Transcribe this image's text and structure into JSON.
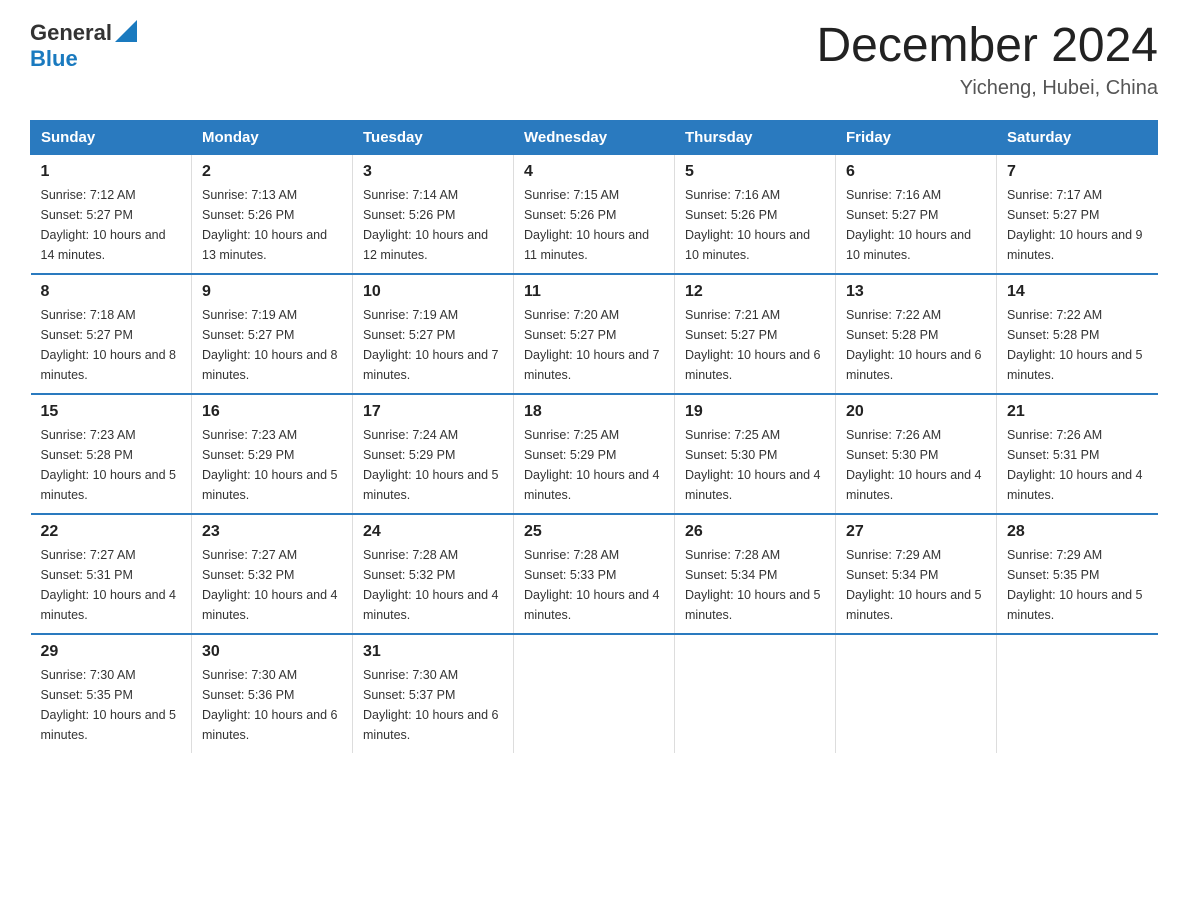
{
  "header": {
    "logo": {
      "general": "General",
      "blue": "Blue"
    },
    "title": "December 2024",
    "location": "Yicheng, Hubei, China"
  },
  "days_of_week": [
    "Sunday",
    "Monday",
    "Tuesday",
    "Wednesday",
    "Thursday",
    "Friday",
    "Saturday"
  ],
  "weeks": [
    [
      {
        "day": "1",
        "sunrise": "7:12 AM",
        "sunset": "5:27 PM",
        "daylight": "10 hours and 14 minutes."
      },
      {
        "day": "2",
        "sunrise": "7:13 AM",
        "sunset": "5:26 PM",
        "daylight": "10 hours and 13 minutes."
      },
      {
        "day": "3",
        "sunrise": "7:14 AM",
        "sunset": "5:26 PM",
        "daylight": "10 hours and 12 minutes."
      },
      {
        "day": "4",
        "sunrise": "7:15 AM",
        "sunset": "5:26 PM",
        "daylight": "10 hours and 11 minutes."
      },
      {
        "day": "5",
        "sunrise": "7:16 AM",
        "sunset": "5:26 PM",
        "daylight": "10 hours and 10 minutes."
      },
      {
        "day": "6",
        "sunrise": "7:16 AM",
        "sunset": "5:27 PM",
        "daylight": "10 hours and 10 minutes."
      },
      {
        "day": "7",
        "sunrise": "7:17 AM",
        "sunset": "5:27 PM",
        "daylight": "10 hours and 9 minutes."
      }
    ],
    [
      {
        "day": "8",
        "sunrise": "7:18 AM",
        "sunset": "5:27 PM",
        "daylight": "10 hours and 8 minutes."
      },
      {
        "day": "9",
        "sunrise": "7:19 AM",
        "sunset": "5:27 PM",
        "daylight": "10 hours and 8 minutes."
      },
      {
        "day": "10",
        "sunrise": "7:19 AM",
        "sunset": "5:27 PM",
        "daylight": "10 hours and 7 minutes."
      },
      {
        "day": "11",
        "sunrise": "7:20 AM",
        "sunset": "5:27 PM",
        "daylight": "10 hours and 7 minutes."
      },
      {
        "day": "12",
        "sunrise": "7:21 AM",
        "sunset": "5:27 PM",
        "daylight": "10 hours and 6 minutes."
      },
      {
        "day": "13",
        "sunrise": "7:22 AM",
        "sunset": "5:28 PM",
        "daylight": "10 hours and 6 minutes."
      },
      {
        "day": "14",
        "sunrise": "7:22 AM",
        "sunset": "5:28 PM",
        "daylight": "10 hours and 5 minutes."
      }
    ],
    [
      {
        "day": "15",
        "sunrise": "7:23 AM",
        "sunset": "5:28 PM",
        "daylight": "10 hours and 5 minutes."
      },
      {
        "day": "16",
        "sunrise": "7:23 AM",
        "sunset": "5:29 PM",
        "daylight": "10 hours and 5 minutes."
      },
      {
        "day": "17",
        "sunrise": "7:24 AM",
        "sunset": "5:29 PM",
        "daylight": "10 hours and 5 minutes."
      },
      {
        "day": "18",
        "sunrise": "7:25 AM",
        "sunset": "5:29 PM",
        "daylight": "10 hours and 4 minutes."
      },
      {
        "day": "19",
        "sunrise": "7:25 AM",
        "sunset": "5:30 PM",
        "daylight": "10 hours and 4 minutes."
      },
      {
        "day": "20",
        "sunrise": "7:26 AM",
        "sunset": "5:30 PM",
        "daylight": "10 hours and 4 minutes."
      },
      {
        "day": "21",
        "sunrise": "7:26 AM",
        "sunset": "5:31 PM",
        "daylight": "10 hours and 4 minutes."
      }
    ],
    [
      {
        "day": "22",
        "sunrise": "7:27 AM",
        "sunset": "5:31 PM",
        "daylight": "10 hours and 4 minutes."
      },
      {
        "day": "23",
        "sunrise": "7:27 AM",
        "sunset": "5:32 PM",
        "daylight": "10 hours and 4 minutes."
      },
      {
        "day": "24",
        "sunrise": "7:28 AM",
        "sunset": "5:32 PM",
        "daylight": "10 hours and 4 minutes."
      },
      {
        "day": "25",
        "sunrise": "7:28 AM",
        "sunset": "5:33 PM",
        "daylight": "10 hours and 4 minutes."
      },
      {
        "day": "26",
        "sunrise": "7:28 AM",
        "sunset": "5:34 PM",
        "daylight": "10 hours and 5 minutes."
      },
      {
        "day": "27",
        "sunrise": "7:29 AM",
        "sunset": "5:34 PM",
        "daylight": "10 hours and 5 minutes."
      },
      {
        "day": "28",
        "sunrise": "7:29 AM",
        "sunset": "5:35 PM",
        "daylight": "10 hours and 5 minutes."
      }
    ],
    [
      {
        "day": "29",
        "sunrise": "7:30 AM",
        "sunset": "5:35 PM",
        "daylight": "10 hours and 5 minutes."
      },
      {
        "day": "30",
        "sunrise": "7:30 AM",
        "sunset": "5:36 PM",
        "daylight": "10 hours and 6 minutes."
      },
      {
        "day": "31",
        "sunrise": "7:30 AM",
        "sunset": "5:37 PM",
        "daylight": "10 hours and 6 minutes."
      },
      null,
      null,
      null,
      null
    ]
  ]
}
